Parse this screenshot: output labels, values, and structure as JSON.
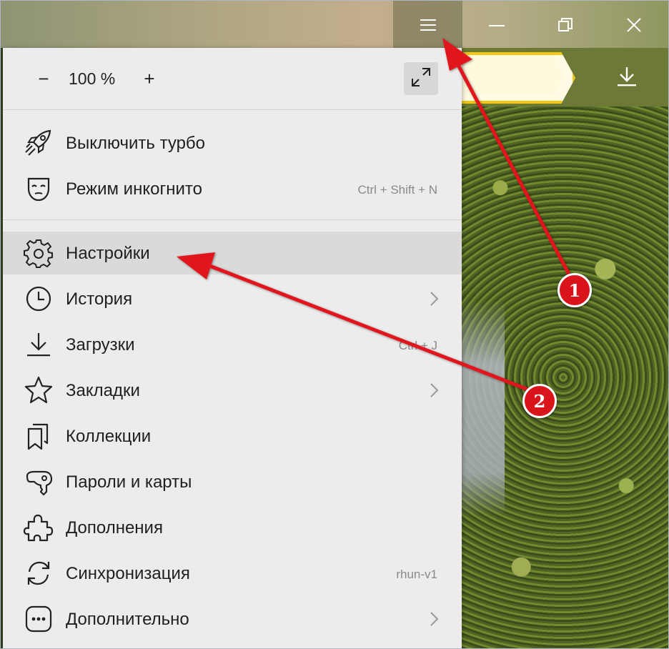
{
  "window": {
    "menu_icon": "hamburger-icon",
    "minimize_icon": "minimize-icon",
    "restore_icon": "restore-icon",
    "close_icon": "close-icon"
  },
  "toolbar": {
    "download_icon": "download-icon",
    "omnibox_accent": "#f3c812"
  },
  "menu": {
    "zoom": {
      "minus": "−",
      "value": "100 %",
      "plus": "+",
      "fullscreen_icon": "fullscreen-icon"
    },
    "top_items": [
      {
        "label": "Выключить турбо",
        "icon": "rocket-icon",
        "hint": ""
      },
      {
        "label": "Режим инкогнито",
        "icon": "mask-icon",
        "hint": "Ctrl + Shift + N"
      }
    ],
    "items": [
      {
        "label": "Настройки",
        "icon": "gear-icon",
        "hint": "",
        "highlighted": true
      },
      {
        "label": "История",
        "icon": "clock-icon",
        "hint": "",
        "submenu": true
      },
      {
        "label": "Загрузки",
        "icon": "download-icon",
        "hint": "Ctrl + J"
      },
      {
        "label": "Закладки",
        "icon": "star-icon",
        "hint": "",
        "submenu": true
      },
      {
        "label": "Коллекции",
        "icon": "collections-icon",
        "hint": ""
      },
      {
        "label": "Пароли и карты",
        "icon": "key-icon",
        "hint": ""
      },
      {
        "label": "Дополнения",
        "icon": "puzzle-icon",
        "hint": ""
      },
      {
        "label": "Синхронизация",
        "icon": "sync-icon",
        "hint": "rhun-v1"
      },
      {
        "label": "Дополнительно",
        "icon": "more-icon",
        "hint": "",
        "submenu": true
      }
    ]
  },
  "annotations": {
    "step1": "1",
    "step2": "2",
    "color": "#e0171d"
  }
}
